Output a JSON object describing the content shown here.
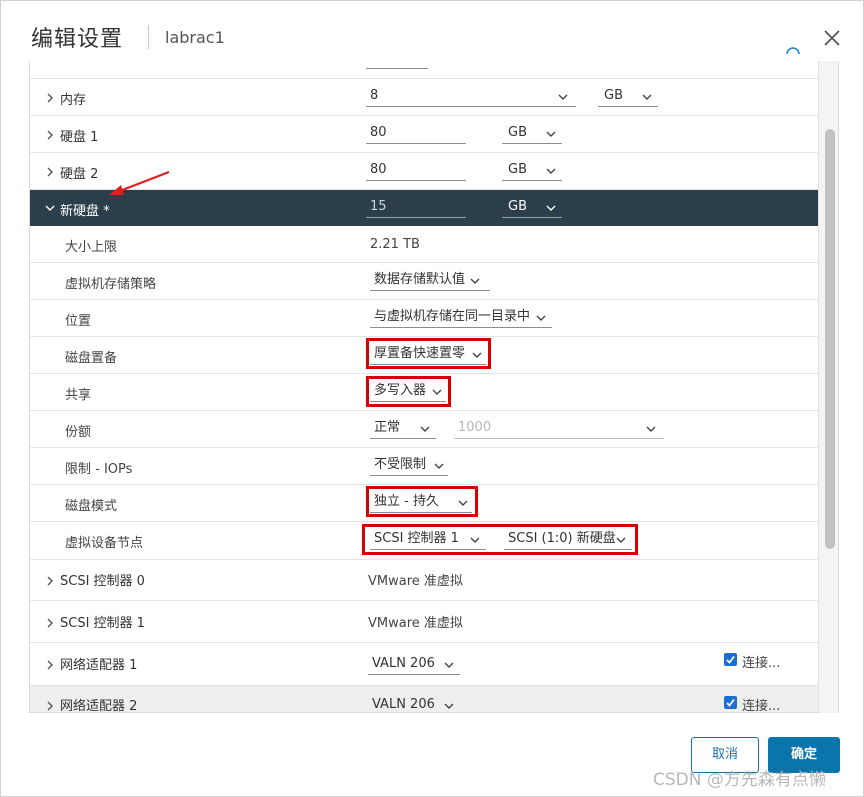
{
  "dialog": {
    "title": "编辑设置",
    "subtitle": "labrac1"
  },
  "rows": {
    "memory": {
      "label": "内存",
      "value": "8",
      "unit": "GB"
    },
    "disk1": {
      "label": "硬盘 1",
      "value": "80",
      "unit": "GB"
    },
    "disk2": {
      "label": "硬盘 2",
      "value": "80",
      "unit": "GB"
    },
    "new_disk": {
      "label": "新硬盘 *",
      "value": "15",
      "unit": "GB"
    },
    "max_size": {
      "label": "大小上限",
      "value": "2.21 TB"
    },
    "storage_policy": {
      "label": "虚拟机存储策略",
      "value": "数据存储默认值"
    },
    "location": {
      "label": "位置",
      "value": "与虚拟机存储在同一目录中"
    },
    "provisioning": {
      "label": "磁盘置备",
      "value": "厚置备快速置零"
    },
    "sharing": {
      "label": "共享",
      "value": "多写入器"
    },
    "shares": {
      "label": "份额",
      "value": "正常",
      "number": "1000"
    },
    "limit_iops": {
      "label": "限制 - IOPs",
      "value": "不受限制"
    },
    "disk_mode": {
      "label": "磁盘模式",
      "value": "独立 - 持久"
    },
    "device_node": {
      "label": "虚拟设备节点",
      "controller": "SCSI 控制器 1",
      "node": "SCSI (1:0) 新硬盘"
    },
    "scsi0": {
      "label": "SCSI 控制器 0",
      "value": "VMware 准虚拟"
    },
    "scsi1": {
      "label": "SCSI 控制器 1",
      "value": "VMware 准虚拟"
    },
    "nic1": {
      "label": "网络适配器 1",
      "value": "VALN 206",
      "connect": "连接..."
    },
    "nic2": {
      "label": "网络适配器 2",
      "value": "VALN 206",
      "connect": "连接..."
    }
  },
  "buttons": {
    "cancel": "取消",
    "ok": "确定"
  },
  "watermark": "CSDN @方先森有点懒",
  "colors": {
    "selected_row": "#2b3e4b",
    "primary": "#0a75ad",
    "highlight_box": "#d90000",
    "annotation_arrow": "#e02020"
  }
}
